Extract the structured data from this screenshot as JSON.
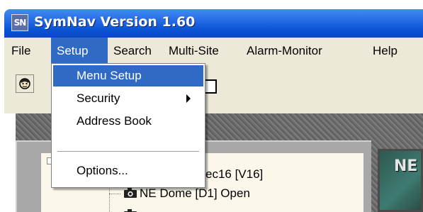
{
  "window": {
    "app_icon_text": "SN",
    "title": "SymNav Version 1.60"
  },
  "menubar": {
    "items": [
      "File",
      "Setup",
      "Search",
      "Multi-Site",
      "Alarm-Monitor",
      "Help"
    ],
    "active": "Setup"
  },
  "dropdown": {
    "items": [
      {
        "label": "Menu Setup",
        "highlighted": true
      },
      {
        "label": "Security",
        "has_submenu": true
      },
      {
        "label": "Address Book"
      },
      {
        "label": "Options..."
      }
    ]
  },
  "tree": {
    "partial_text": "ec16 [V16]",
    "selected_node": "NE Dome  [D1] Open"
  },
  "monitor": {
    "label": "NE"
  },
  "colors": {
    "titlebar": "#0a54d6",
    "menu_highlight": "#316ac5",
    "menubar_bg": "#ece9d8"
  },
  "icons": {
    "toolbar_icon": "user-face-icon",
    "tree_node_icon": "camera-icon"
  }
}
